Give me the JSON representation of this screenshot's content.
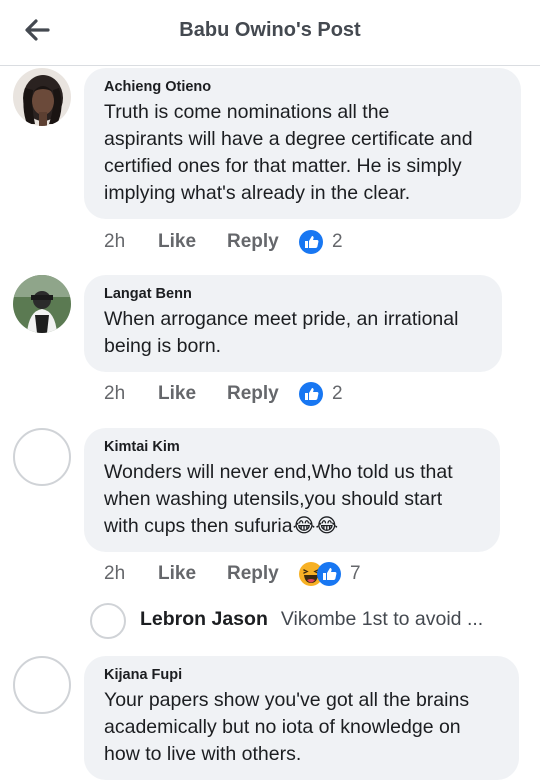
{
  "header": {
    "title": "Babu Owino's Post"
  },
  "comments": [
    {
      "author": "Achieng Otieno",
      "text": "Truth is come nominations all the\naspirants will have a degree certificate and\ncertified ones for that matter. He is simply\nimplying what's already in the clear.",
      "time": "2h",
      "like_label": "Like",
      "reply_label": "Reply",
      "reaction_icons": [
        "like-reaction-icon"
      ],
      "reaction_count": "2"
    },
    {
      "author": "Langat Benn",
      "text": "When arrogance meet pride, an irrational\nbeing is born.",
      "time": "2h",
      "like_label": "Like",
      "reply_label": "Reply",
      "reaction_icons": [
        "like-reaction-icon"
      ],
      "reaction_count": "2"
    },
    {
      "author": "Kimtai Kim",
      "text": "Wonders will never end,Who told us that\nwhen washing utensils,you should start\nwith cups then sufuria😂😂",
      "time": "2h",
      "like_label": "Like",
      "reply_label": "Reply",
      "reaction_icons": [
        "haha-reaction-icon",
        "like-reaction-icon"
      ],
      "reaction_count": "7",
      "reply_preview": {
        "author": "Lebron Jason",
        "text": "Vikombe 1st to avoid ..."
      }
    },
    {
      "author": "Kijana Fupi",
      "text": "Your papers show you've got all the brains\nacademically but no iota of knowledge on\nhow to live with others."
    }
  ],
  "colors": {
    "like_blue": "#1877f2",
    "bubble_bg": "#f0f2f5",
    "meta_gray": "#65676b"
  }
}
